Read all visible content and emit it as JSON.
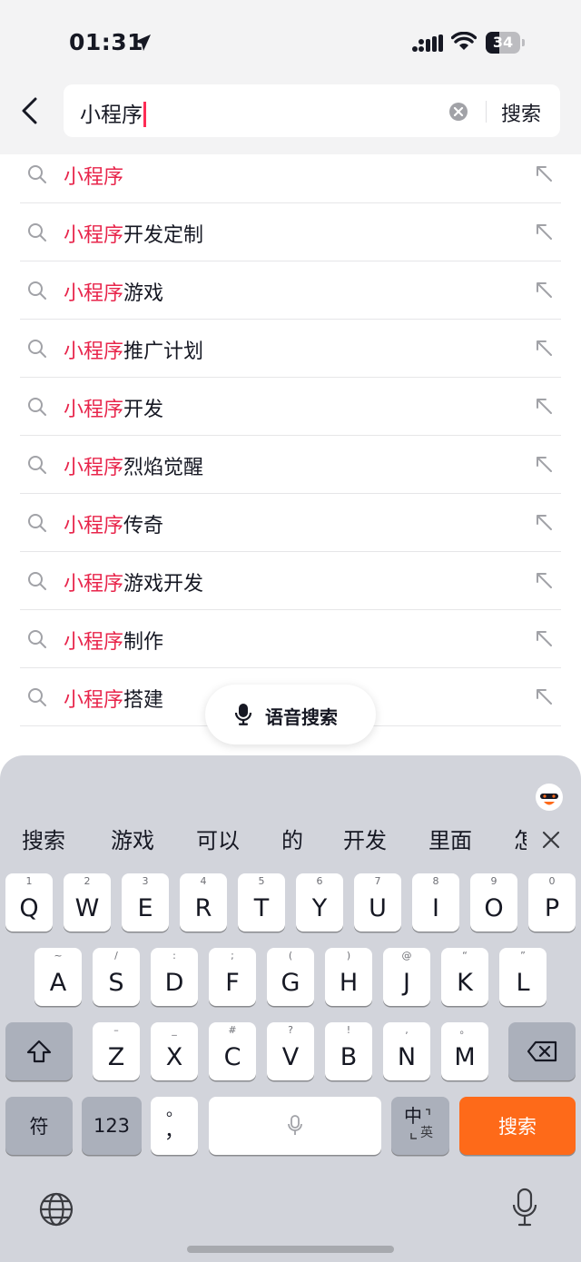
{
  "status": {
    "time": "01:31",
    "battery": "34"
  },
  "header": {
    "query": "小程序",
    "search_label": "搜索"
  },
  "suggestions": [
    {
      "highlight": "小程序",
      "rest": ""
    },
    {
      "highlight": "小程序",
      "rest": "开发定制"
    },
    {
      "highlight": "小程序",
      "rest": "游戏"
    },
    {
      "highlight": "小程序",
      "rest": "推广计划"
    },
    {
      "highlight": "小程序",
      "rest": "开发"
    },
    {
      "highlight": "小程序",
      "rest": "烈焰觉醒"
    },
    {
      "highlight": "小程序",
      "rest": "传奇"
    },
    {
      "highlight": "小程序",
      "rest": "游戏开发"
    },
    {
      "highlight": "小程序",
      "rest": "制作"
    },
    {
      "highlight": "小程序",
      "rest": "搭建"
    }
  ],
  "voice_search": {
    "label": "语音搜索"
  },
  "keyboard": {
    "candidates": [
      "搜索",
      "游戏",
      "可以",
      "的",
      "开发",
      "里面",
      "怎"
    ],
    "row1": [
      {
        "main": "Q",
        "sub": "1"
      },
      {
        "main": "W",
        "sub": "2"
      },
      {
        "main": "E",
        "sub": "3"
      },
      {
        "main": "R",
        "sub": "4"
      },
      {
        "main": "T",
        "sub": "5"
      },
      {
        "main": "Y",
        "sub": "6"
      },
      {
        "main": "U",
        "sub": "7"
      },
      {
        "main": "I",
        "sub": "8"
      },
      {
        "main": "O",
        "sub": "9"
      },
      {
        "main": "P",
        "sub": "0"
      }
    ],
    "row2": [
      {
        "main": "A",
        "sub": "~"
      },
      {
        "main": "S",
        "sub": "/"
      },
      {
        "main": "D",
        "sub": ":"
      },
      {
        "main": "F",
        "sub": ";"
      },
      {
        "main": "G",
        "sub": "("
      },
      {
        "main": "H",
        "sub": ")"
      },
      {
        "main": "J",
        "sub": "@"
      },
      {
        "main": "K",
        "sub": "“"
      },
      {
        "main": "L",
        "sub": "”"
      }
    ],
    "row3": [
      {
        "main": "Z",
        "sub": "–"
      },
      {
        "main": "X",
        "sub": "_"
      },
      {
        "main": "C",
        "sub": "#"
      },
      {
        "main": "V",
        "sub": "?"
      },
      {
        "main": "B",
        "sub": "!"
      },
      {
        "main": "N",
        "sub": ","
      },
      {
        "main": "M",
        "sub": "。"
      }
    ],
    "symbols_label": "符",
    "numbers_label": "123",
    "punct_top": "。",
    "punct_bottom": "，",
    "lang_main": "中",
    "lang_sub": "英",
    "action_label": "搜索"
  },
  "colors": {
    "highlight": "#e8254b",
    "action": "#fe6a19"
  }
}
